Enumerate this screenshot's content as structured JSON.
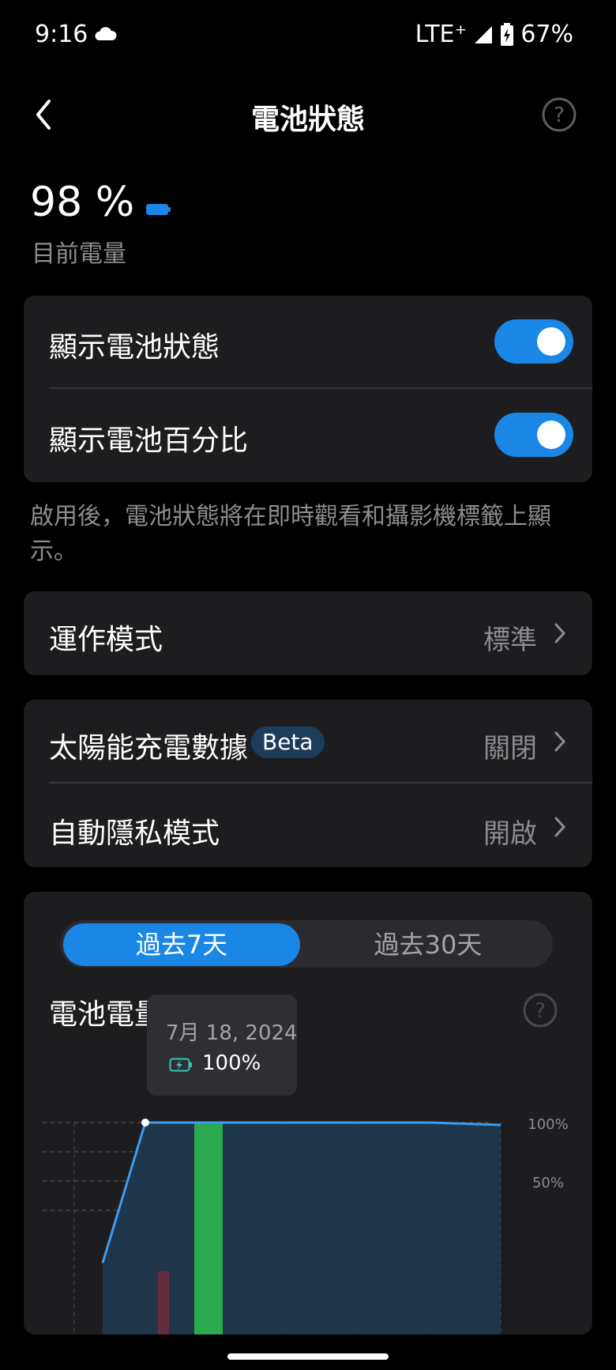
{
  "status_bar": {
    "time": "9:16",
    "network": "LTE⁺",
    "battery_percent": "67%",
    "icons": [
      "cloud-icon",
      "signal-icon",
      "battery-charging-icon"
    ]
  },
  "header": {
    "title": "電池狀態",
    "icons": [
      "back-arrow-icon",
      "help-icon"
    ]
  },
  "battery": {
    "level": "98 %",
    "label": "目前電量"
  },
  "toggles": [
    {
      "label": "顯示電池狀態",
      "on": true
    },
    {
      "label": "顯示電池百分比",
      "on": true
    }
  ],
  "note": "啟用後，電池狀態將在即時觀看和攝影機標籤上顯示。",
  "operating_mode": {
    "label": "運作模式",
    "value": "標準"
  },
  "settings": [
    {
      "label": "太陽能充電數據",
      "badge": "Beta",
      "value": "關閉"
    },
    {
      "label": "自動隱私模式",
      "badge": "",
      "value": "開啟"
    }
  ],
  "chart_section": {
    "tabs": [
      "過去7天",
      "過去30天"
    ],
    "active_tab": 0,
    "title": "電池電量",
    "tooltip": {
      "date": "7月 18, 2024",
      "value": "100%"
    }
  },
  "colors": {
    "accent": "#1a86e6",
    "card": "#1d1d20",
    "line": "#3b9cf2",
    "charging": "#2ebd4f",
    "tooltip_icon": "#36c6b8"
  },
  "chart_data": {
    "type": "line",
    "ylabel": "",
    "yticks": [
      "100%",
      "50%"
    ],
    "ylim": [
      0,
      100
    ],
    "series": [
      {
        "values_x": [
          0,
          1,
          2,
          3,
          4,
          5,
          6
        ],
        "values_y": [
          -20,
          100,
          100,
          100,
          100,
          100,
          98
        ]
      }
    ],
    "charging_bands_y": [
      100
    ]
  }
}
